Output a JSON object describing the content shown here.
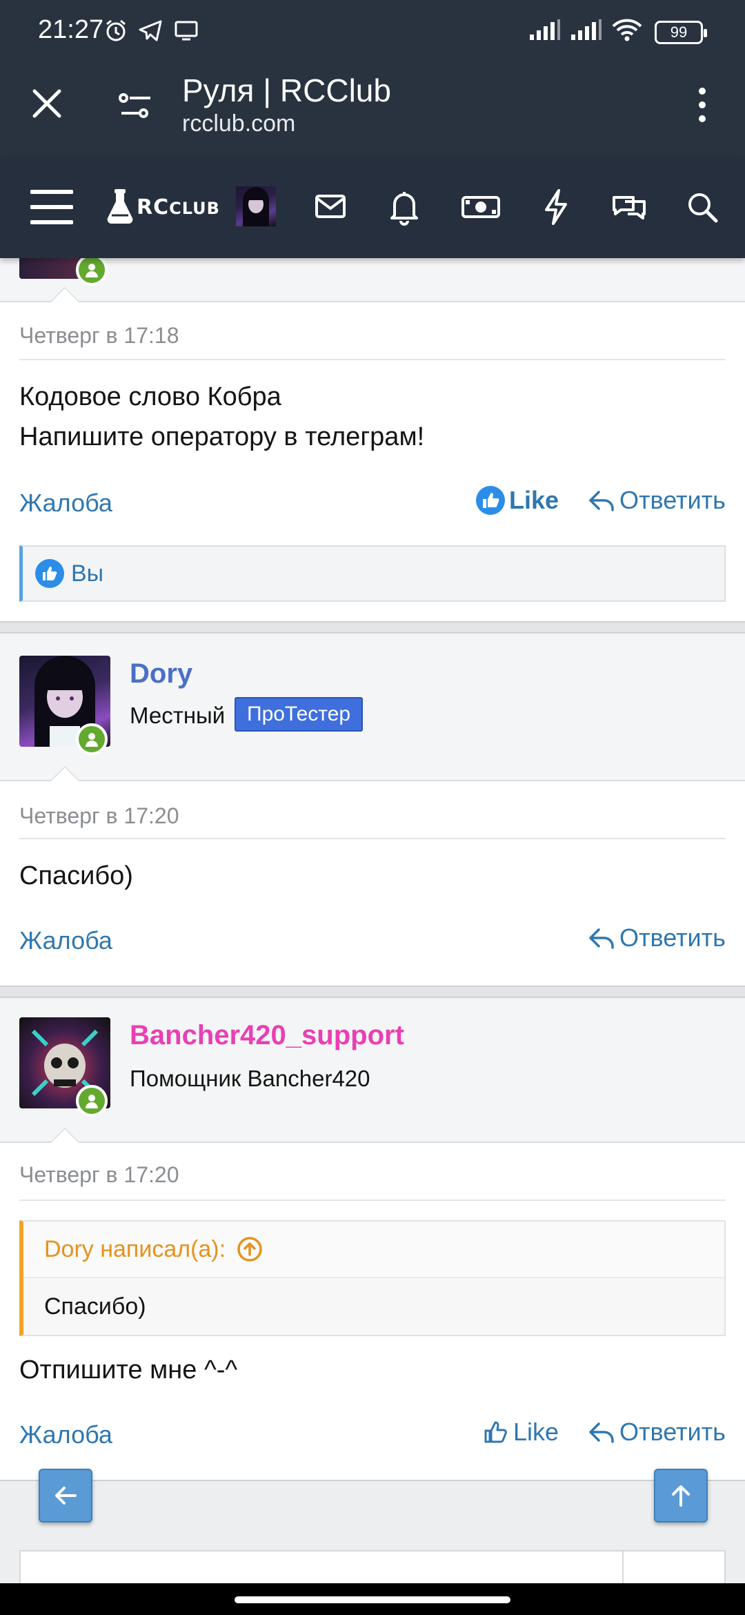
{
  "status_bar": {
    "time": "21:27",
    "battery": "99"
  },
  "browser": {
    "title": "Руля | RCClub",
    "url": "rcclub.com"
  },
  "site_nav": {
    "logo_text": "RC",
    "logo_text_small": "CLUB"
  },
  "post1": {
    "date": "Четверг в 17:18",
    "message_lines": [
      "Кодовое слово Кобра",
      "Напишите оператору в телеграм!"
    ],
    "report": "Жалоба",
    "like": "Like",
    "reply": "Ответить",
    "reactions": "Вы"
  },
  "post2": {
    "author": "Dory",
    "author_color": "#4a6fc9",
    "user_title": "Местный",
    "badge": "ПроТестер",
    "date": "Четверг в 17:20",
    "message": "Спасибо)",
    "report": "Жалоба",
    "reply": "Ответить"
  },
  "post3": {
    "author": "Bancher420_support",
    "author_color": "#e83fb5",
    "user_title": "Помощник Bancher420",
    "date": "Четверг в 17:20",
    "quote_author": "Dory написал(а):",
    "quote_text": "Спасибо)",
    "message": "Отпишите мне ^-^",
    "report": "Жалоба",
    "like": "Like",
    "reply": "Ответить"
  }
}
